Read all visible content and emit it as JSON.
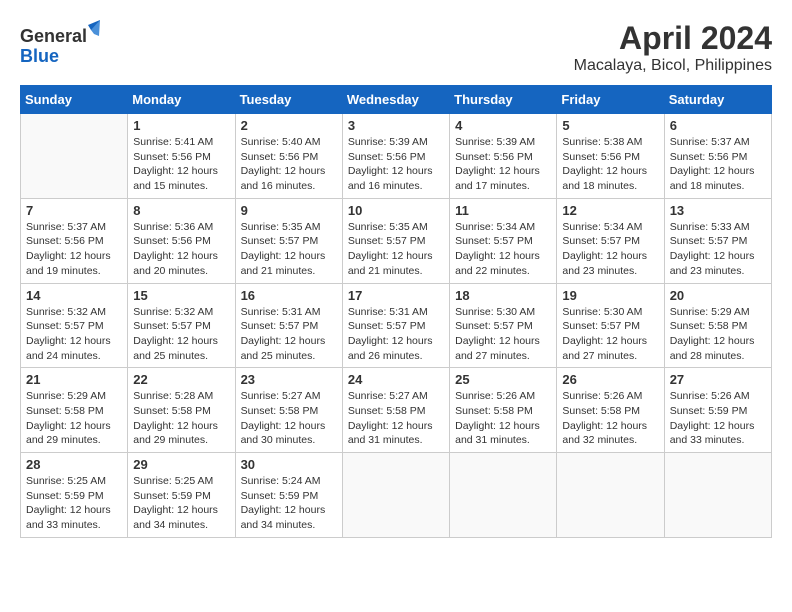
{
  "header": {
    "logo_general": "General",
    "logo_blue": "Blue",
    "title": "April 2024",
    "subtitle": "Macalaya, Bicol, Philippines"
  },
  "calendar": {
    "days_of_week": [
      "Sunday",
      "Monday",
      "Tuesday",
      "Wednesday",
      "Thursday",
      "Friday",
      "Saturday"
    ],
    "weeks": [
      [
        {
          "day": "",
          "info": ""
        },
        {
          "day": "1",
          "info": "Sunrise: 5:41 AM\nSunset: 5:56 PM\nDaylight: 12 hours\nand 15 minutes."
        },
        {
          "day": "2",
          "info": "Sunrise: 5:40 AM\nSunset: 5:56 PM\nDaylight: 12 hours\nand 16 minutes."
        },
        {
          "day": "3",
          "info": "Sunrise: 5:39 AM\nSunset: 5:56 PM\nDaylight: 12 hours\nand 16 minutes."
        },
        {
          "day": "4",
          "info": "Sunrise: 5:39 AM\nSunset: 5:56 PM\nDaylight: 12 hours\nand 17 minutes."
        },
        {
          "day": "5",
          "info": "Sunrise: 5:38 AM\nSunset: 5:56 PM\nDaylight: 12 hours\nand 18 minutes."
        },
        {
          "day": "6",
          "info": "Sunrise: 5:37 AM\nSunset: 5:56 PM\nDaylight: 12 hours\nand 18 minutes."
        }
      ],
      [
        {
          "day": "7",
          "info": "Sunrise: 5:37 AM\nSunset: 5:56 PM\nDaylight: 12 hours\nand 19 minutes."
        },
        {
          "day": "8",
          "info": "Sunrise: 5:36 AM\nSunset: 5:56 PM\nDaylight: 12 hours\nand 20 minutes."
        },
        {
          "day": "9",
          "info": "Sunrise: 5:35 AM\nSunset: 5:57 PM\nDaylight: 12 hours\nand 21 minutes."
        },
        {
          "day": "10",
          "info": "Sunrise: 5:35 AM\nSunset: 5:57 PM\nDaylight: 12 hours\nand 21 minutes."
        },
        {
          "day": "11",
          "info": "Sunrise: 5:34 AM\nSunset: 5:57 PM\nDaylight: 12 hours\nand 22 minutes."
        },
        {
          "day": "12",
          "info": "Sunrise: 5:34 AM\nSunset: 5:57 PM\nDaylight: 12 hours\nand 23 minutes."
        },
        {
          "day": "13",
          "info": "Sunrise: 5:33 AM\nSunset: 5:57 PM\nDaylight: 12 hours\nand 23 minutes."
        }
      ],
      [
        {
          "day": "14",
          "info": "Sunrise: 5:32 AM\nSunset: 5:57 PM\nDaylight: 12 hours\nand 24 minutes."
        },
        {
          "day": "15",
          "info": "Sunrise: 5:32 AM\nSunset: 5:57 PM\nDaylight: 12 hours\nand 25 minutes."
        },
        {
          "day": "16",
          "info": "Sunrise: 5:31 AM\nSunset: 5:57 PM\nDaylight: 12 hours\nand 25 minutes."
        },
        {
          "day": "17",
          "info": "Sunrise: 5:31 AM\nSunset: 5:57 PM\nDaylight: 12 hours\nand 26 minutes."
        },
        {
          "day": "18",
          "info": "Sunrise: 5:30 AM\nSunset: 5:57 PM\nDaylight: 12 hours\nand 27 minutes."
        },
        {
          "day": "19",
          "info": "Sunrise: 5:30 AM\nSunset: 5:57 PM\nDaylight: 12 hours\nand 27 minutes."
        },
        {
          "day": "20",
          "info": "Sunrise: 5:29 AM\nSunset: 5:58 PM\nDaylight: 12 hours\nand 28 minutes."
        }
      ],
      [
        {
          "day": "21",
          "info": "Sunrise: 5:29 AM\nSunset: 5:58 PM\nDaylight: 12 hours\nand 29 minutes."
        },
        {
          "day": "22",
          "info": "Sunrise: 5:28 AM\nSunset: 5:58 PM\nDaylight: 12 hours\nand 29 minutes."
        },
        {
          "day": "23",
          "info": "Sunrise: 5:27 AM\nSunset: 5:58 PM\nDaylight: 12 hours\nand 30 minutes."
        },
        {
          "day": "24",
          "info": "Sunrise: 5:27 AM\nSunset: 5:58 PM\nDaylight: 12 hours\nand 31 minutes."
        },
        {
          "day": "25",
          "info": "Sunrise: 5:26 AM\nSunset: 5:58 PM\nDaylight: 12 hours\nand 31 minutes."
        },
        {
          "day": "26",
          "info": "Sunrise: 5:26 AM\nSunset: 5:58 PM\nDaylight: 12 hours\nand 32 minutes."
        },
        {
          "day": "27",
          "info": "Sunrise: 5:26 AM\nSunset: 5:59 PM\nDaylight: 12 hours\nand 33 minutes."
        }
      ],
      [
        {
          "day": "28",
          "info": "Sunrise: 5:25 AM\nSunset: 5:59 PM\nDaylight: 12 hours\nand 33 minutes."
        },
        {
          "day": "29",
          "info": "Sunrise: 5:25 AM\nSunset: 5:59 PM\nDaylight: 12 hours\nand 34 minutes."
        },
        {
          "day": "30",
          "info": "Sunrise: 5:24 AM\nSunset: 5:59 PM\nDaylight: 12 hours\nand 34 minutes."
        },
        {
          "day": "",
          "info": ""
        },
        {
          "day": "",
          "info": ""
        },
        {
          "day": "",
          "info": ""
        },
        {
          "day": "",
          "info": ""
        }
      ]
    ]
  }
}
